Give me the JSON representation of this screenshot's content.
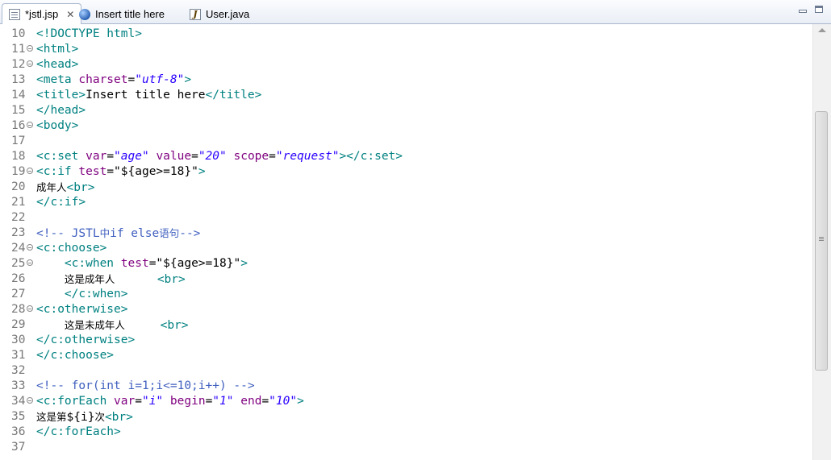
{
  "tabs": [
    {
      "label": "*jstl.jsp",
      "icon": "jsp-file-icon",
      "active": true,
      "closable": true
    },
    {
      "label": "Insert title here",
      "icon": "browser-globe-icon",
      "active": false
    },
    {
      "label": "User.java",
      "icon": "java-file-icon",
      "active": false
    }
  ],
  "editor": {
    "lines": [
      {
        "n": "10",
        "fold": false,
        "segs": [
          [
            "tag",
            "<!DOCTYPE html>"
          ]
        ]
      },
      {
        "n": "11",
        "fold": true,
        "segs": [
          [
            "tag",
            "<html>"
          ]
        ]
      },
      {
        "n": "12",
        "fold": true,
        "segs": [
          [
            "tag",
            "<head>"
          ]
        ]
      },
      {
        "n": "13",
        "fold": false,
        "segs": [
          [
            "tag",
            "<meta "
          ],
          [
            "attr",
            "charset"
          ],
          [
            "txt",
            "="
          ],
          [
            "val",
            "\"utf-8\""
          ],
          [
            "tag",
            ">"
          ]
        ]
      },
      {
        "n": "14",
        "fold": false,
        "segs": [
          [
            "tag",
            "<title>"
          ],
          [
            "txt",
            "Insert title here"
          ],
          [
            "tag",
            "</title>"
          ]
        ]
      },
      {
        "n": "15",
        "fold": false,
        "segs": [
          [
            "tag",
            "</head>"
          ]
        ]
      },
      {
        "n": "16",
        "fold": true,
        "segs": [
          [
            "tag",
            "<body>"
          ]
        ]
      },
      {
        "n": "17",
        "fold": false,
        "segs": []
      },
      {
        "n": "18",
        "fold": false,
        "segs": [
          [
            "tag",
            "<c:set "
          ],
          [
            "attr",
            "var"
          ],
          [
            "txt",
            "="
          ],
          [
            "val",
            "\"age\""
          ],
          [
            "txt",
            " "
          ],
          [
            "attr",
            "value"
          ],
          [
            "txt",
            "="
          ],
          [
            "val",
            "\"20\""
          ],
          [
            "txt",
            " "
          ],
          [
            "attr",
            "scope"
          ],
          [
            "txt",
            "="
          ],
          [
            "val",
            "\"request\""
          ],
          [
            "tag",
            "></c:set>"
          ]
        ]
      },
      {
        "n": "19",
        "fold": true,
        "segs": [
          [
            "tag",
            "<c:if "
          ],
          [
            "attr",
            "test"
          ],
          [
            "txt",
            "=\"${age>=18}\""
          ],
          [
            "tag",
            ">"
          ]
        ]
      },
      {
        "n": "20",
        "fold": false,
        "segs": [
          [
            "cjk",
            "成年人"
          ],
          [
            "tag",
            "<br>"
          ]
        ]
      },
      {
        "n": "21",
        "fold": false,
        "segs": [
          [
            "tag",
            "</c:if>"
          ]
        ]
      },
      {
        "n": "22",
        "fold": false,
        "segs": []
      },
      {
        "n": "23",
        "fold": false,
        "segs": [
          [
            "cmt",
            "<!-- JSTL"
          ],
          [
            "cmtcjk",
            "中"
          ],
          [
            "cmt",
            "if else"
          ],
          [
            "cmtcjk",
            "语句"
          ],
          [
            "cmt",
            "-->"
          ]
        ]
      },
      {
        "n": "24",
        "fold": true,
        "segs": [
          [
            "tag",
            "<c:choose>"
          ]
        ]
      },
      {
        "n": "25",
        "fold": true,
        "segs": [
          [
            "txt",
            "    "
          ],
          [
            "tag",
            "<c:when "
          ],
          [
            "attr",
            "test"
          ],
          [
            "txt",
            "=\"${age>=18}\""
          ],
          [
            "tag",
            ">"
          ]
        ]
      },
      {
        "n": "26",
        "fold": false,
        "segs": [
          [
            "txt",
            "    "
          ],
          [
            "cjk",
            "这是成年人"
          ],
          [
            "txt",
            "      "
          ],
          [
            "tag",
            "<br>"
          ]
        ]
      },
      {
        "n": "27",
        "fold": false,
        "segs": [
          [
            "txt",
            "    "
          ],
          [
            "tag",
            "</c:when>"
          ]
        ]
      },
      {
        "n": "28",
        "fold": true,
        "segs": [
          [
            "tag",
            "<c:otherwise>"
          ]
        ]
      },
      {
        "n": "29",
        "fold": false,
        "segs": [
          [
            "txt",
            "    "
          ],
          [
            "cjk",
            "这是未成年人"
          ],
          [
            "txt",
            "     "
          ],
          [
            "tag",
            "<br>"
          ]
        ]
      },
      {
        "n": "30",
        "fold": false,
        "segs": [
          [
            "tag",
            "</c:otherwise>"
          ]
        ]
      },
      {
        "n": "31",
        "fold": false,
        "segs": [
          [
            "tag",
            "</c:choose>"
          ]
        ]
      },
      {
        "n": "32",
        "fold": false,
        "segs": []
      },
      {
        "n": "33",
        "fold": false,
        "segs": [
          [
            "cmt",
            "<!-- for(int i=1;i<=10;i++) -->"
          ]
        ]
      },
      {
        "n": "34",
        "fold": true,
        "segs": [
          [
            "tag",
            "<c:forEach "
          ],
          [
            "attr",
            "var"
          ],
          [
            "txt",
            "="
          ],
          [
            "val",
            "\"i\""
          ],
          [
            "txt",
            " "
          ],
          [
            "attr",
            "begin"
          ],
          [
            "txt",
            "="
          ],
          [
            "val",
            "\"1\""
          ],
          [
            "txt",
            " "
          ],
          [
            "attr",
            "end"
          ],
          [
            "txt",
            "="
          ],
          [
            "val",
            "\"10\""
          ],
          [
            "tag",
            ">"
          ]
        ]
      },
      {
        "n": "35",
        "fold": false,
        "segs": [
          [
            "cjk",
            "这是第"
          ],
          [
            "txt",
            "${i}"
          ],
          [
            "cjk",
            "次"
          ],
          [
            "tag",
            "<br>"
          ]
        ]
      },
      {
        "n": "36",
        "fold": false,
        "segs": [
          [
            "tag",
            "</c:forEach>"
          ]
        ]
      },
      {
        "n": "37",
        "fold": false,
        "segs": []
      }
    ]
  }
}
